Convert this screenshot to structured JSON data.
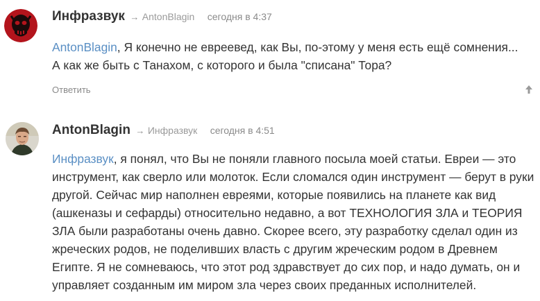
{
  "comments": [
    {
      "author": "Инфразвук",
      "arrow": "→",
      "reply_to": "AntonBlagin",
      "date": "сегодня в 4:37",
      "mention": "AntonBlagin",
      "body_line1": ",  Я конечно не евреевед, как Вы, по-этому у меня есть ещё сомнения...",
      "body_line2": "А как же быть с Танахом, с которого и была \"списана\" Тора?",
      "reply_label": "Ответить",
      "avatar_icon": "red-skull-avatar-icon",
      "up_icon": "arrow-up-icon"
    },
    {
      "author": "AntonBlagin",
      "arrow": "→",
      "reply_to": "Инфразвук",
      "date": "сегодня в 4:51",
      "mention": "Инфразвук",
      "body": ", я понял, что Вы не поняли главного посыла моей статьи. Евреи — это инструмент, как сверло или молоток. Если сломался один инструмент — берут в руки другой. Сейчас мир наполнен евреями, которые появились на планете как вид (ашкеназы и сефарды) относительно недавно, а вот ТЕХНОЛОГИЯ ЗЛА и ТЕОРИЯ ЗЛА были разработаны очень давно. Скорее всего, эту разработку сделал один из жреческих родов, не поделивших власть с другим жреческим родом в Древнем Египте. Я не сомневаюсь, что этот род здравствует до сих пор, и надо думать, он и управляет созданным им миром зла через своих преданных исполнителей.",
      "avatar_icon": "man-portrait-avatar-icon"
    }
  ],
  "colors": {
    "text": "#333333",
    "meta": "#8a8a8a",
    "link": "#5a8fc4",
    "avatar1_bg": "#b3141c"
  }
}
